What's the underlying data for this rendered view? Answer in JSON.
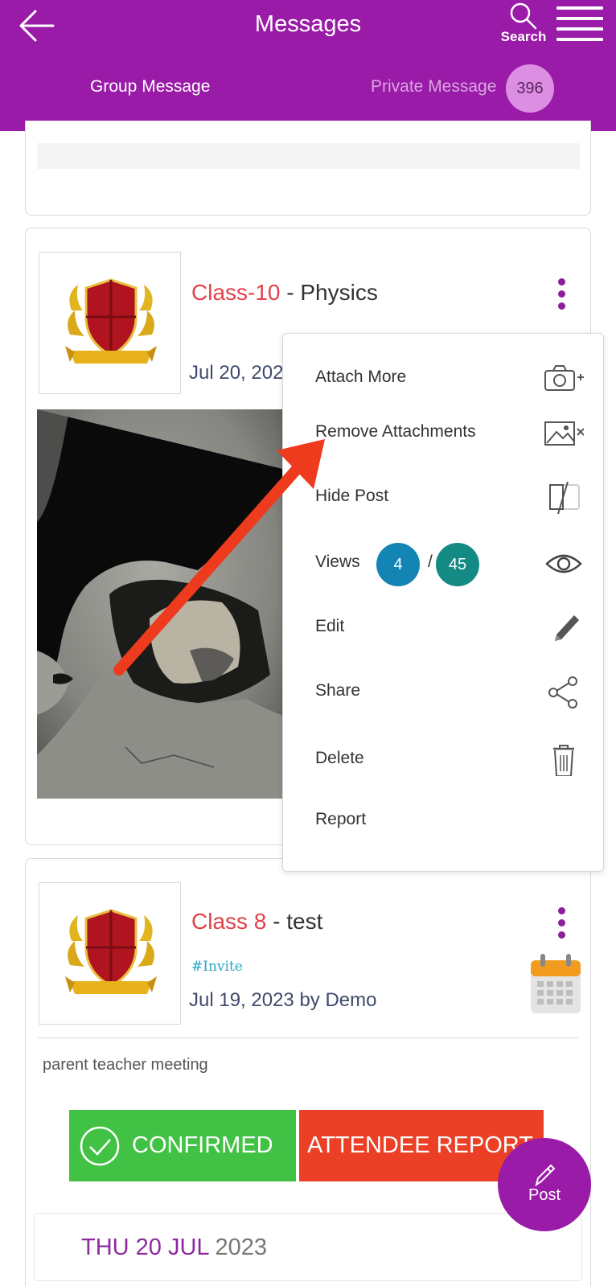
{
  "header": {
    "title": "Messages",
    "search_label": "Search",
    "tabs": {
      "group": "Group Message",
      "private": "Private Message",
      "private_count": "396"
    },
    "color": "#9a1ba8"
  },
  "posts": [
    {
      "class_name": "Class-10",
      "separator": " - ",
      "subject": "Physics",
      "date": "Jul 20, 202"
    },
    {
      "class_name": "Class 8",
      "separator": " - ",
      "subject": "test",
      "hashtag": "#Invite",
      "date": "Jul 19, 2023  by Demo",
      "description": "parent teacher meeting",
      "confirm_label": "CONFIRMED",
      "attendee_label": "ATTENDEE REPORT",
      "event_date_highlight": "THU 20 JUL",
      "event_date_year": " 2023"
    }
  ],
  "context_menu": {
    "items": [
      {
        "label": "Attach More",
        "icon": "camera-plus-icon"
      },
      {
        "label": "Remove Attachments",
        "icon": "image-remove-icon"
      },
      {
        "label": "Hide Post",
        "icon": "hide-post-icon"
      },
      {
        "label": "Views",
        "icon": "eye-icon"
      },
      {
        "label": "Edit",
        "icon": "pencil-icon"
      },
      {
        "label": "Share",
        "icon": "share-icon"
      },
      {
        "label": "Delete",
        "icon": "trash-icon"
      },
      {
        "label": "Report",
        "icon": ""
      }
    ],
    "views_seen": "4",
    "views_separator": "/",
    "views_total": "45",
    "views_seen_color": "#1384b4",
    "views_total_color": "#138a83"
  },
  "fab": {
    "label": "Post"
  },
  "colors": {
    "class_red": "#e0424b",
    "confirm_green": "#42c244",
    "attendee_red": "#eb3f26",
    "annotation_arrow": "#ee3a1d"
  }
}
